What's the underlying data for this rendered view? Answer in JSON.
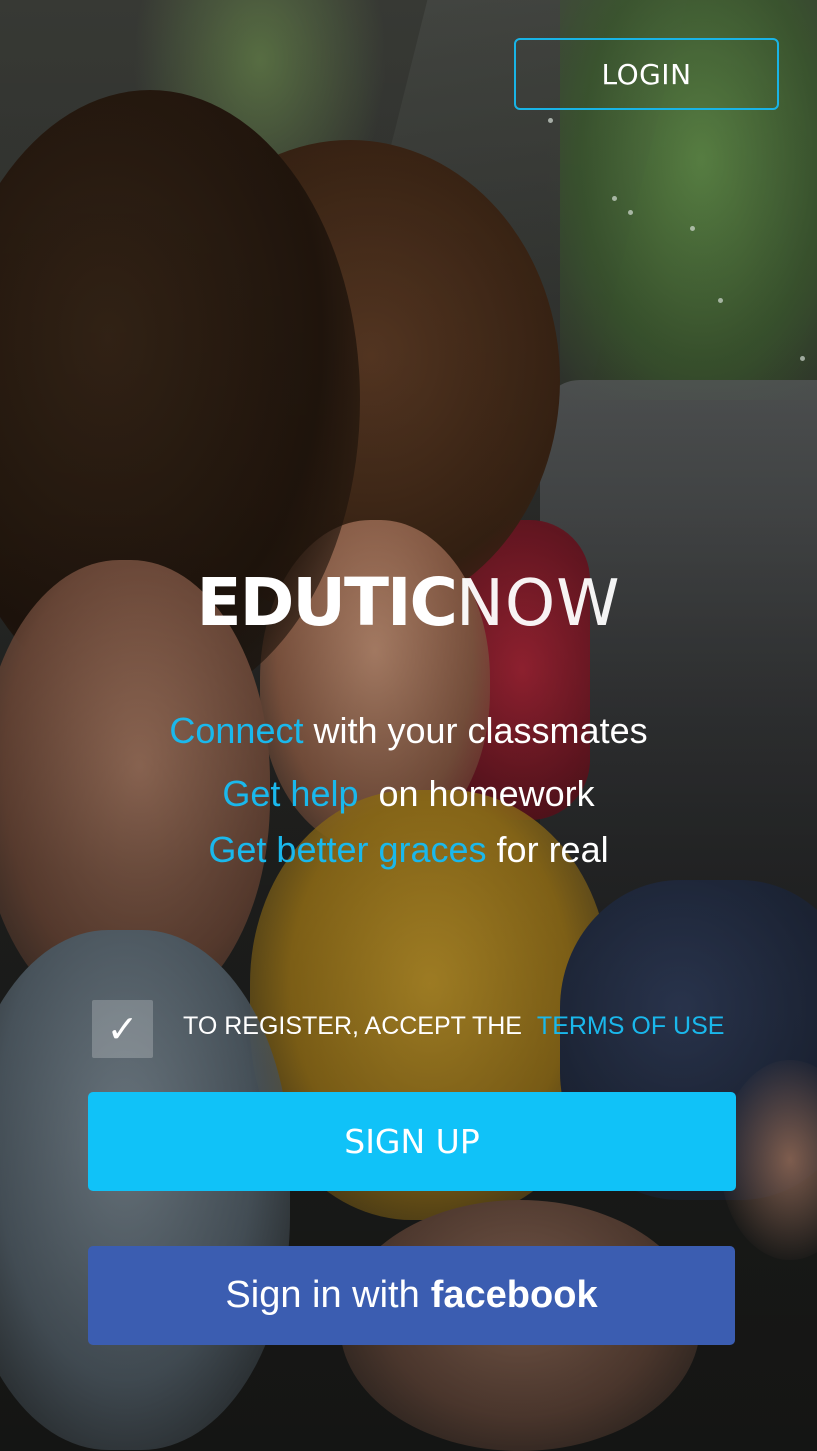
{
  "header": {
    "login_label": "LOGIN"
  },
  "brand": {
    "logo_bold": "EDUTIC",
    "logo_light": "NOW"
  },
  "taglines": [
    {
      "highlight": "Connect",
      "rest": " with your classmates"
    },
    {
      "highlight": "Get help",
      "rest": "on homework"
    },
    {
      "highlight": "Get better graces",
      "rest": " for real"
    }
  ],
  "terms": {
    "checkbox_mark": "✓",
    "checked": true,
    "prefix": "TO REGISTER, ACCEPT THE",
    "link": "TERMS OF USE"
  },
  "actions": {
    "signup_label": "SIGN UP",
    "facebook_prefix": "Sign in with",
    "facebook_brand": "facebook"
  },
  "colors": {
    "accent": "#1ab8ec",
    "signup_bg": "#10c2f8",
    "facebook_bg": "#3b5db1",
    "text": "#ffffff"
  }
}
